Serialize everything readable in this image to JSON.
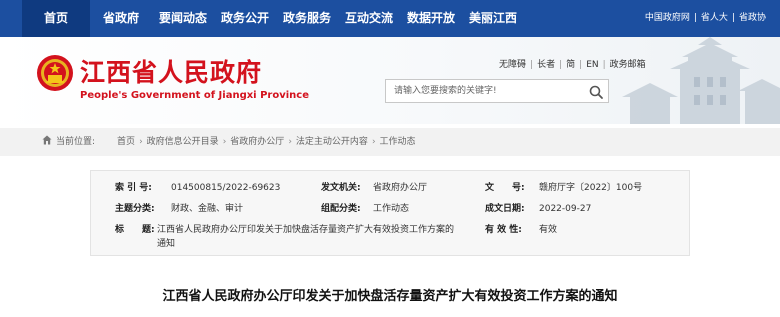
{
  "topnav": {
    "items": [
      {
        "label": "首页"
      },
      {
        "label": "省政府"
      },
      {
        "label": "要闻动态"
      },
      {
        "label": "政务公开"
      },
      {
        "label": "政务服务"
      },
      {
        "label": "互动交流"
      },
      {
        "label": "数据开放"
      },
      {
        "label": "美丽江西"
      }
    ],
    "right_links": [
      "中国政府网",
      "省人大",
      "省政协"
    ]
  },
  "banner": {
    "title": "江西省人民政府",
    "subtitle": "People's Government of Jiangxi Province",
    "access_links": [
      "无障碍",
      "长者",
      "简",
      "EN",
      "政务邮箱"
    ],
    "search": {
      "placeholder": "请输入您要搜索的关键字!"
    }
  },
  "breadcrumb": {
    "label": "当前位置:",
    "items": [
      "首页",
      "政府信息公开目录",
      "省政府办公厅",
      "法定主动公开内容",
      "工作动态"
    ]
  },
  "meta": {
    "index_label": "索 引 号:",
    "index_value": "014500815/2022-69623",
    "issuer_label": "发文机关:",
    "issuer_value": "省政府办公厅",
    "docno_label": "文　　号:",
    "docno_value": "赣府厅字〔2022〕100号",
    "subject_label": "主题分类:",
    "subject_value": "财政、金融、审计",
    "category_label": "组配分类:",
    "category_value": "工作动态",
    "date_label": "成文日期:",
    "date_value": "2022-09-27",
    "title_label": "标　　题:",
    "title_value_1": "江西省人民政府办公厅印发关于加快盘活存量资产扩大有效投资工作方案的",
    "title_value_2": "通知",
    "valid_label": "有 效 性:",
    "valid_value": "有效"
  },
  "article": {
    "title": "江西省人民政府办公厅印发关于加快盘活存量资产扩大有效投资工作方案的通知"
  },
  "colors": {
    "nav_bg": "#1c4fa0",
    "brand_red": "#d3121d"
  }
}
